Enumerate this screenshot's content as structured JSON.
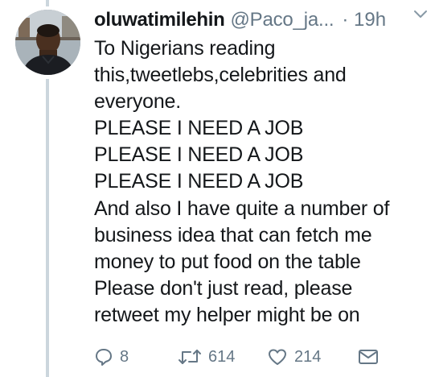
{
  "tweet": {
    "author": {
      "name": "oluwatimilehin",
      "handle": "@Paco_ja...",
      "timestamp": "· 19h"
    },
    "lines": [
      "To Nigerians reading",
      "this,tweetlebs,celebrities and",
      "everyone.",
      "PLEASE I NEED A JOB",
      "PLEASE I NEED A JOB",
      "PLEASE I NEED A JOB",
      "And also I have quite a number of",
      "business idea that can fetch me",
      "money to put food on the table",
      "Please don't just read, please",
      "retweet my helper might be on"
    ],
    "actions": {
      "reply_count": "8",
      "retweet_count": "614",
      "like_count": "214"
    }
  },
  "icons": {
    "menu": "chevron-down-icon",
    "reply": "reply-icon",
    "retweet": "retweet-icon",
    "like": "heart-icon",
    "message": "envelope-icon"
  },
  "colors": {
    "text": "#14171a",
    "secondary": "#657786",
    "thread_line": "#ccd6dd"
  }
}
